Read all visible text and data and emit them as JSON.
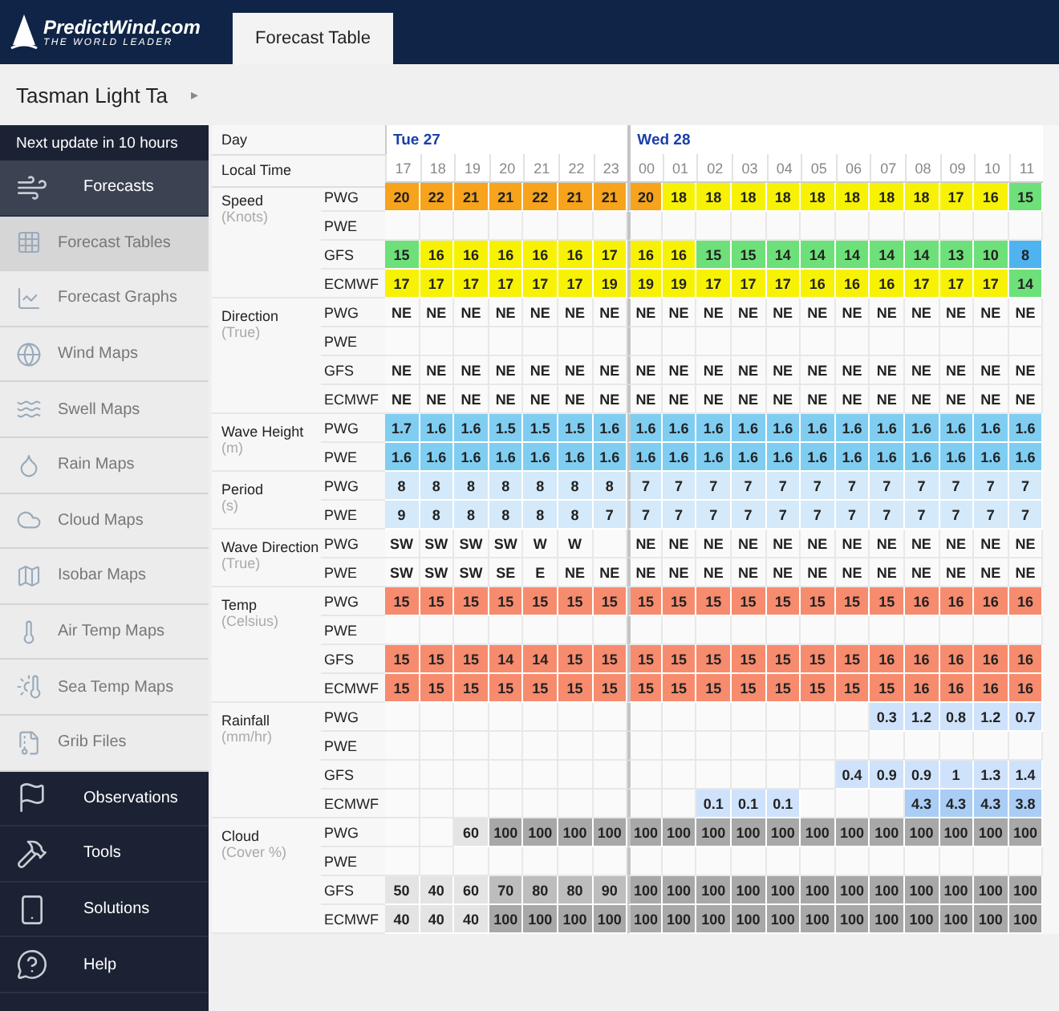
{
  "logo": {
    "name": "PredictWind.com",
    "tagline": "THE WORLD LEADER"
  },
  "tabs": [
    {
      "label": "Forecast Table",
      "selected": true
    }
  ],
  "sidebar": {
    "location": "Tasman Light Ta",
    "location_arrow": "▸",
    "update_notice": "Next update in 10 hours",
    "items": [
      {
        "label": "Forecasts",
        "kind": "section",
        "selected": true
      },
      {
        "label": "Forecast Tables",
        "kind": "sub",
        "selected": true
      },
      {
        "label": "Forecast Graphs",
        "kind": "sub",
        "selected": false
      },
      {
        "label": "Wind Maps",
        "kind": "sub",
        "selected": false
      },
      {
        "label": "Swell Maps",
        "kind": "sub",
        "selected": false
      },
      {
        "label": "Rain Maps",
        "kind": "sub",
        "selected": false
      },
      {
        "label": "Cloud Maps",
        "kind": "sub",
        "selected": false
      },
      {
        "label": "Isobar Maps",
        "kind": "sub",
        "selected": false
      },
      {
        "label": "Air Temp Maps",
        "kind": "sub",
        "selected": false
      },
      {
        "label": "Sea Temp Maps",
        "kind": "sub",
        "selected": false
      },
      {
        "label": "Grib Files",
        "kind": "sub",
        "selected": false
      },
      {
        "label": "Observations",
        "kind": "section",
        "selected": false
      },
      {
        "label": "Tools",
        "kind": "section",
        "selected": false
      },
      {
        "label": "Solutions",
        "kind": "section",
        "selected": false
      },
      {
        "label": "Help",
        "kind": "section",
        "selected": false
      }
    ]
  },
  "table": {
    "day_label": "Day",
    "time_label": "Local Time",
    "days": [
      {
        "label": "Tue 27",
        "hours": [
          "17",
          "18",
          "19",
          "20",
          "21",
          "22",
          "23"
        ]
      },
      {
        "label": "Wed 28",
        "hours": [
          "00",
          "01",
          "02",
          "03",
          "04",
          "05",
          "06",
          "07",
          "08",
          "09",
          "10",
          "11"
        ]
      }
    ],
    "groups": [
      {
        "name": "Speed",
        "unit": "(Knots)",
        "kind": "speed",
        "rows": [
          {
            "source": "PWG",
            "values": [
              "20",
              "22",
              "21",
              "21",
              "22",
              "21",
              "21",
              "20",
              "18",
              "18",
              "18",
              "18",
              "18",
              "18",
              "18",
              "18",
              "17",
              "16",
              "15"
            ]
          },
          {
            "source": "PWE"
          },
          {
            "source": "GFS",
            "values": [
              "15",
              "16",
              "16",
              "16",
              "16",
              "16",
              "17",
              "16",
              "16",
              "15",
              "15",
              "14",
              "14",
              "14",
              "14",
              "14",
              "13",
              "10",
              "8"
            ]
          },
          {
            "source": "ECMWF",
            "values": [
              "17",
              "17",
              "17",
              "17",
              "17",
              "17",
              "19",
              "19",
              "19",
              "17",
              "17",
              "17",
              "16",
              "16",
              "16",
              "17",
              "17",
              "17",
              "14"
            ]
          }
        ]
      },
      {
        "name": "Direction",
        "unit": "(True)",
        "kind": "direction",
        "rows": [
          {
            "source": "PWG",
            "values": [
              "NE",
              "NE",
              "NE",
              "NE",
              "NE",
              "NE",
              "NE",
              "NE",
              "NE",
              "NE",
              "NE",
              "NE",
              "NE",
              "NE",
              "NE",
              "NE",
              "NE",
              "NE",
              "NE"
            ]
          },
          {
            "source": "PWE"
          },
          {
            "source": "GFS",
            "values": [
              "NE",
              "NE",
              "NE",
              "NE",
              "NE",
              "NE",
              "NE",
              "NE",
              "NE",
              "NE",
              "NE",
              "NE",
              "NE",
              "NE",
              "NE",
              "NE",
              "NE",
              "NE",
              "NE"
            ]
          },
          {
            "source": "ECMWF",
            "values": [
              "NE",
              "NE",
              "NE",
              "NE",
              "NE",
              "NE",
              "NE",
              "NE",
              "NE",
              "NE",
              "NE",
              "NE",
              "NE",
              "NE",
              "NE",
              "NE",
              "NE",
              "NE",
              "NE"
            ]
          }
        ]
      },
      {
        "name": "Wave Height",
        "unit": "(m)",
        "kind": "wave",
        "rows": [
          {
            "source": "PWG",
            "values": [
              "1.7",
              "1.6",
              "1.6",
              "1.5",
              "1.5",
              "1.5",
              "1.6",
              "1.6",
              "1.6",
              "1.6",
              "1.6",
              "1.6",
              "1.6",
              "1.6",
              "1.6",
              "1.6",
              "1.6",
              "1.6",
              "1.6"
            ]
          },
          {
            "source": "PWE",
            "values": [
              "1.6",
              "1.6",
              "1.6",
              "1.6",
              "1.6",
              "1.6",
              "1.6",
              "1.6",
              "1.6",
              "1.6",
              "1.6",
              "1.6",
              "1.6",
              "1.6",
              "1.6",
              "1.6",
              "1.6",
              "1.6",
              "1.6"
            ]
          }
        ]
      },
      {
        "name": "Period",
        "unit": "(s)",
        "kind": "period",
        "rows": [
          {
            "source": "PWG",
            "values": [
              "8",
              "8",
              "8",
              "8",
              "8",
              "8",
              "8",
              "7",
              "7",
              "7",
              "7",
              "7",
              "7",
              "7",
              "7",
              "7",
              "7",
              "7",
              "7"
            ]
          },
          {
            "source": "PWE",
            "values": [
              "9",
              "8",
              "8",
              "8",
              "8",
              "8",
              "7",
              "7",
              "7",
              "7",
              "7",
              "7",
              "7",
              "7",
              "7",
              "7",
              "7",
              "7",
              "7"
            ]
          }
        ]
      },
      {
        "name": "Wave Direction",
        "unit": "(True)",
        "kind": "direction",
        "rows": [
          {
            "source": "PWG",
            "values": [
              "SW",
              "SW",
              "SW",
              "SW",
              "W",
              "W",
              {
                "blank": true
              },
              "NE",
              "NE",
              "NE",
              "NE",
              "NE",
              "NE",
              "NE",
              "NE",
              "NE",
              "NE",
              "NE",
              "NE"
            ]
          },
          {
            "source": "PWE",
            "values": [
              "SW",
              "SW",
              "SW",
              "SE",
              "E",
              "NE",
              "NE",
              "NE",
              "NE",
              "NE",
              "NE",
              "NE",
              "NE",
              "NE",
              "NE",
              "NE",
              "NE",
              "NE",
              "NE"
            ]
          }
        ]
      },
      {
        "name": "Temp",
        "unit": "(Celsius)",
        "kind": "temp",
        "rows": [
          {
            "source": "PWG",
            "values": [
              "15",
              "15",
              "15",
              "15",
              "15",
              "15",
              "15",
              "15",
              "15",
              "15",
              "15",
              "15",
              "15",
              "15",
              "15",
              "16",
              "16",
              "16",
              "16"
            ]
          },
          {
            "source": "PWE"
          },
          {
            "source": "GFS",
            "values": [
              "15",
              "15",
              "15",
              "14",
              "14",
              "15",
              "15",
              "15",
              "15",
              "15",
              "15",
              "15",
              "15",
              "15",
              "16",
              "16",
              "16",
              "16",
              "16"
            ]
          },
          {
            "source": "ECMWF",
            "values": [
              "15",
              "15",
              "15",
              "15",
              "15",
              "15",
              "15",
              "15",
              "15",
              "15",
              "15",
              "15",
              "15",
              "15",
              "15",
              "16",
              "16",
              "16",
              "16"
            ]
          }
        ]
      },
      {
        "name": "Rainfall",
        "unit": "(mm/hr)",
        "kind": "rain",
        "rows": [
          {
            "source": "PWG",
            "values": [
              {
                "blank": true
              },
              {
                "blank": true
              },
              {
                "blank": true
              },
              {
                "blank": true
              },
              {
                "blank": true
              },
              {
                "blank": true
              },
              {
                "blank": true
              },
              {
                "blank": true
              },
              {
                "blank": true
              },
              {
                "blank": true
              },
              {
                "blank": true
              },
              {
                "blank": true
              },
              {
                "blank": true
              },
              {
                "blank": true
              },
              "0.3",
              "1.2",
              "0.8",
              "1.2",
              "0.7"
            ]
          },
          {
            "source": "PWE"
          },
          {
            "source": "GFS",
            "values": [
              {
                "blank": true
              },
              {
                "blank": true
              },
              {
                "blank": true
              },
              {
                "blank": true
              },
              {
                "blank": true
              },
              {
                "blank": true
              },
              {
                "blank": true
              },
              {
                "blank": true
              },
              {
                "blank": true
              },
              {
                "blank": true
              },
              {
                "blank": true
              },
              {
                "blank": true
              },
              {
                "blank": true
              },
              "0.4",
              "0.9",
              "0.9",
              "1",
              "1.3",
              "1.4"
            ]
          },
          {
            "source": "ECMWF",
            "values": [
              {
                "blank": true
              },
              {
                "blank": true
              },
              {
                "blank": true
              },
              {
                "blank": true
              },
              {
                "blank": true
              },
              {
                "blank": true
              },
              {
                "blank": true
              },
              {
                "blank": true
              },
              {
                "blank": true
              },
              "0.1",
              "0.1",
              "0.1",
              {
                "blank": true
              },
              {
                "blank": true
              },
              {
                "blank": true
              },
              "4.3",
              "4.3",
              "4.3",
              "3.8"
            ]
          }
        ]
      },
      {
        "name": "Cloud",
        "unit": "(Cover %)",
        "kind": "cloud",
        "rows": [
          {
            "source": "PWG",
            "values": [
              {
                "blank": true
              },
              {
                "blank": true
              },
              "60",
              "100",
              "100",
              "100",
              "100",
              "100",
              "100",
              "100",
              "100",
              "100",
              "100",
              "100",
              "100",
              "100",
              "100",
              "100",
              "100"
            ]
          },
          {
            "source": "PWE"
          },
          {
            "source": "GFS",
            "values": [
              "50",
              "40",
              "60",
              "70",
              "80",
              "80",
              "90",
              "100",
              "100",
              "100",
              "100",
              "100",
              "100",
              "100",
              "100",
              "100",
              "100",
              "100",
              "100"
            ]
          },
          {
            "source": "ECMWF",
            "values": [
              "40",
              "40",
              "40",
              "100",
              "100",
              "100",
              "100",
              "100",
              "100",
              "100",
              "100",
              "100",
              "100",
              "100",
              "100",
              "100",
              "100",
              "100",
              "100"
            ]
          }
        ]
      }
    ]
  }
}
